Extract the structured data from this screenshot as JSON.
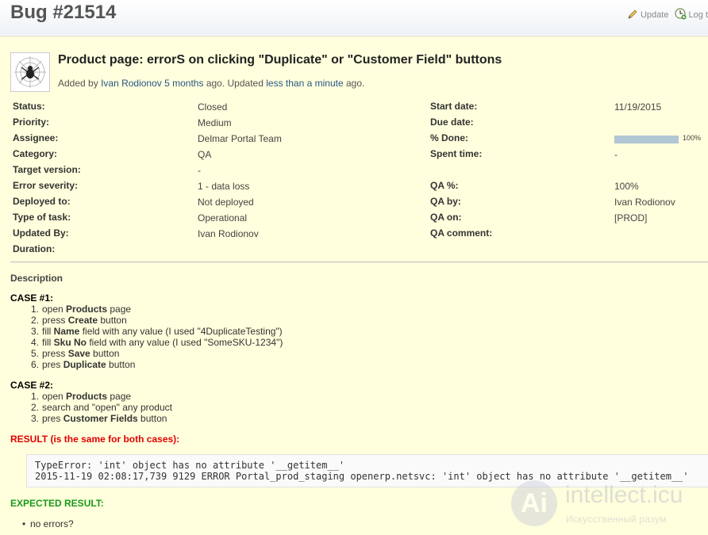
{
  "header": {
    "title": "Bug #21514",
    "update_label": "Update",
    "logtime_label": "Log t"
  },
  "issue": {
    "subject": "Product page: errorS on clicking \"Duplicate\" or \"Customer Field\" buttons",
    "meta": {
      "added_by_prefix": "Added by",
      "author": "Ivan Rodionov",
      "created_ago": "5 months",
      "updated_prefix": "ago. Updated",
      "updated_ago": "less than a minute",
      "suffix": "ago."
    },
    "attributes_left": [
      {
        "label": "Status:",
        "value": "Closed"
      },
      {
        "label": "Priority:",
        "value": "Medium"
      },
      {
        "label": "Assignee:",
        "value": "Delmar Portal Team"
      },
      {
        "label": "Category:",
        "value": "QA"
      },
      {
        "label": "Target version:",
        "value": "-"
      },
      {
        "label": "Error severity:",
        "value": "1 - data loss"
      },
      {
        "label": "Deployed to:",
        "value": "Not deployed"
      },
      {
        "label": "Type of task:",
        "value": "Operational"
      },
      {
        "label": "Updated By:",
        "value": "Ivan Rodionov"
      },
      {
        "label": "Duration:",
        "value": ""
      }
    ],
    "attributes_right": [
      {
        "label": "Start date:",
        "value": "11/19/2015"
      },
      {
        "label": "Due date:",
        "value": ""
      },
      {
        "label": "% Done:",
        "value": "100%",
        "progress": 1.0
      },
      {
        "label": "Spent time:",
        "value": "-"
      },
      {
        "label": "QA %:",
        "value": "100%"
      },
      {
        "label": "QA by:",
        "value": "Ivan Rodionov"
      },
      {
        "label": "QA on:",
        "value": "[PROD]"
      },
      {
        "label": "QA comment:",
        "value": ""
      }
    ]
  },
  "description": {
    "title": "Description",
    "case1": {
      "heading": "CASE #1:",
      "steps": [
        {
          "n": "1.",
          "pre": "open ",
          "bold": "Products",
          "post": " page"
        },
        {
          "n": "2.",
          "pre": "press ",
          "bold": "Create",
          "post": " button"
        },
        {
          "n": "3.",
          "pre": "fill ",
          "bold": "Name",
          "post": " field with any value (I used \"4DuplicateTesting\")"
        },
        {
          "n": "4.",
          "pre": "fill ",
          "bold": "Sku No",
          "post": " field with any value (I used \"SomeSKU-1234\")"
        },
        {
          "n": "5.",
          "pre": "press ",
          "bold": "Save",
          "post": " button"
        },
        {
          "n": "6.",
          "pre": "pres ",
          "bold": "Duplicate",
          "post": " button"
        }
      ]
    },
    "case2": {
      "heading": "CASE #2:",
      "steps": [
        {
          "n": "1.",
          "pre": "open ",
          "bold": "Products",
          "post": " page"
        },
        {
          "n": "2.",
          "pre": "search and \"open\" any product",
          "bold": "",
          "post": ""
        },
        {
          "n": "3.",
          "pre": "pres ",
          "bold": "Customer Fields",
          "post": " button"
        }
      ]
    },
    "result_heading": "RESULT (is the same for both cases):",
    "code_lines": [
      "TypeError: 'int' object has no attribute '__getitem__'",
      "2015-11-19 02:08:17,739 9129 ERROR Portal_prod_staging openerp.netsvc: 'int' object has no attribute '__getitem__'"
    ],
    "expected_heading": "EXPECTED RESULT:",
    "expected_items": [
      "no errors?"
    ]
  },
  "watermark": {
    "letter": "Ai",
    "brand": "intellect.icu",
    "sub": "Искусственный разум"
  },
  "colors": {
    "issue_bg": "#ffffdd",
    "link": "#2a5685",
    "result_red": "#e00000",
    "expected_green": "#1a9a1a"
  }
}
